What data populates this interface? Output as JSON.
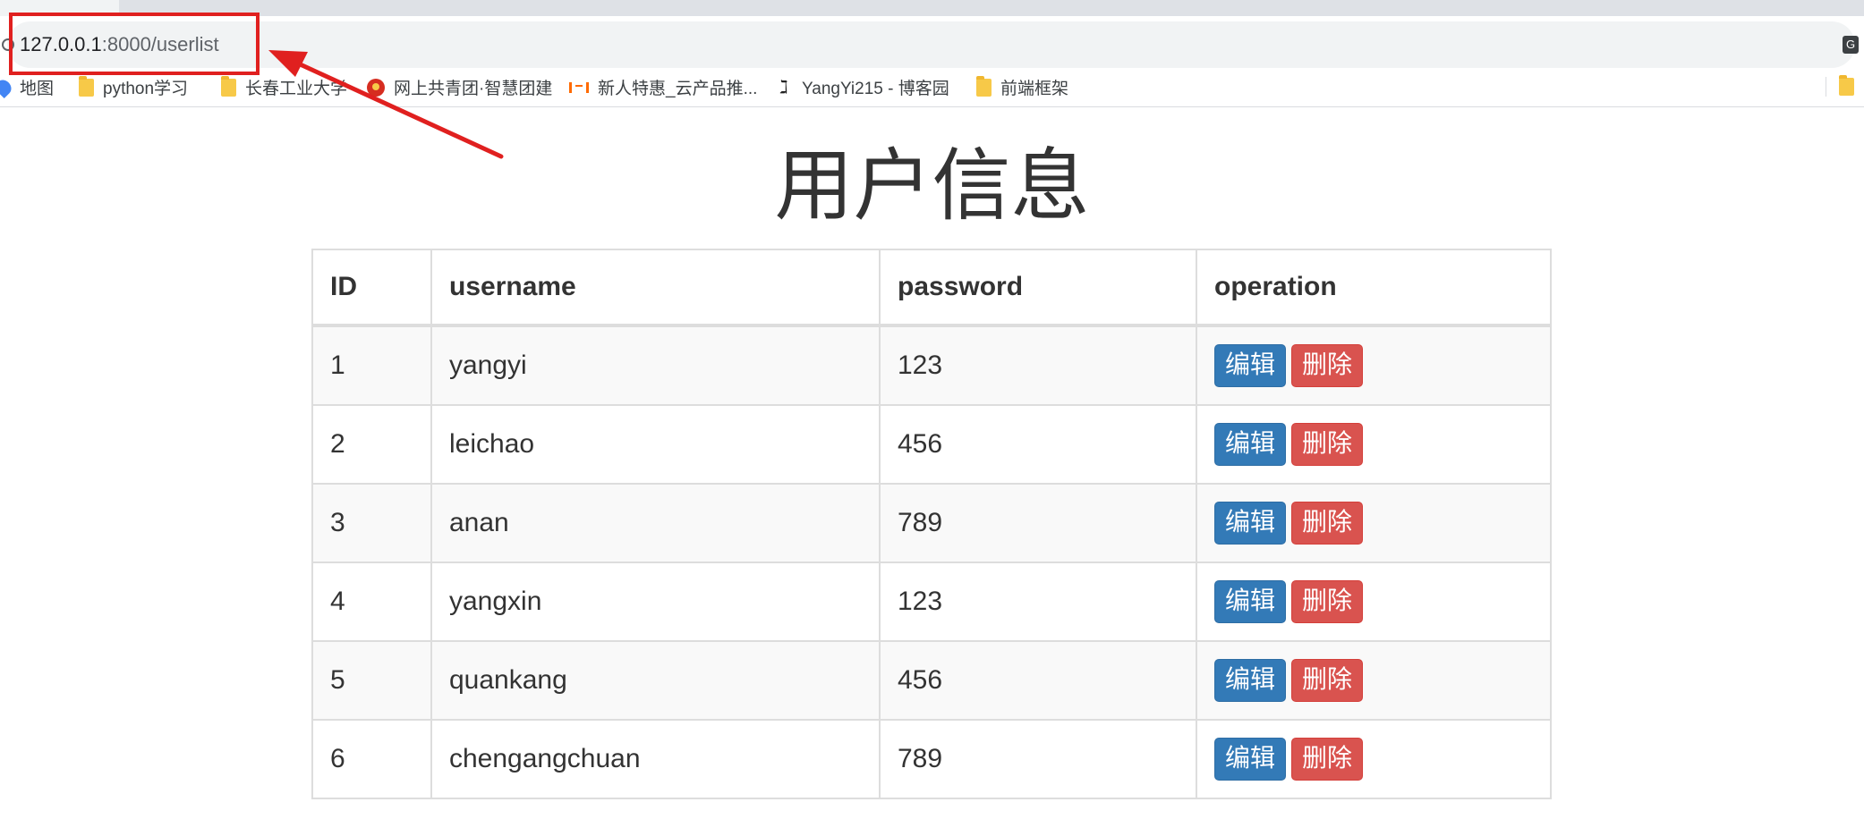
{
  "browser": {
    "url_host": "127.0.0.1",
    "url_path": ":8000/userlist",
    "extension_icon_label": "G"
  },
  "bookmarks": [
    {
      "label": "地图",
      "icon": "map-pin-icon"
    },
    {
      "label": "python学习",
      "icon": "folder-icon"
    },
    {
      "label": "长春工业大学",
      "icon": "folder-icon"
    },
    {
      "label": "网上共青团·智慧团建",
      "icon": "youth-league-icon"
    },
    {
      "label": "新人特惠_云产品推...",
      "icon": "cloud-bracket-icon"
    },
    {
      "label": "YangYi215 - 博客园",
      "icon": "blog-icon"
    },
    {
      "label": "前端框架",
      "icon": "folder-icon"
    }
  ],
  "annotation": {
    "color": "#e0201f"
  },
  "page": {
    "title": "用户信息",
    "table": {
      "headers": [
        "ID",
        "username",
        "password",
        "operation"
      ],
      "rows": [
        {
          "id": "1",
          "username": "yangyi",
          "password": "123"
        },
        {
          "id": "2",
          "username": "leichao",
          "password": "456"
        },
        {
          "id": "3",
          "username": "anan",
          "password": "789"
        },
        {
          "id": "4",
          "username": "yangxin",
          "password": "123"
        },
        {
          "id": "5",
          "username": "quankang",
          "password": "456"
        },
        {
          "id": "6",
          "username": "chengangchuan",
          "password": "789"
        }
      ],
      "edit_label": "编辑",
      "delete_label": "删除"
    },
    "colors": {
      "edit_button": "#337ab7",
      "delete_button": "#d9534f"
    }
  }
}
